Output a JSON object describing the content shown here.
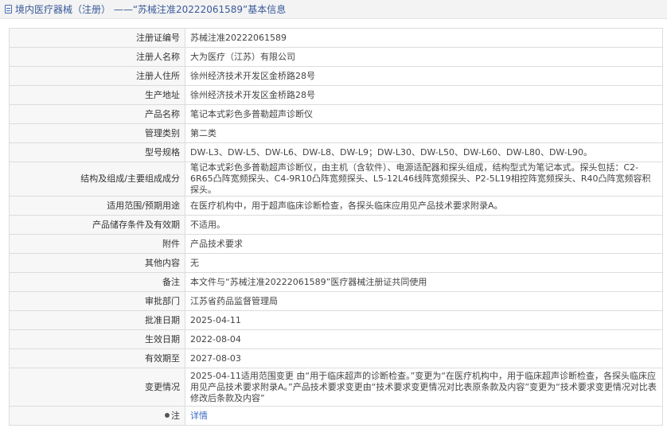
{
  "header": {
    "title": "境内医疗器械（注册） ——“苏械注准20222061589”基本信息"
  },
  "rows": [
    {
      "label": "注册证编号",
      "value": "苏械注准20222061589"
    },
    {
      "label": "注册人名称",
      "value": "大为医疗（江苏）有限公司"
    },
    {
      "label": "注册人住所",
      "value": "徐州经济技术开发区金桥路28号"
    },
    {
      "label": "生产地址",
      "value": "徐州经济技术开发区金桥路28号"
    },
    {
      "label": "产品名称",
      "value": "笔记本式彩色多普勒超声诊断仪"
    },
    {
      "label": "管理类别",
      "value": "第二类"
    },
    {
      "label": "型号规格",
      "value": "DW-L3、DW-L5、DW-L6、DW-L8、DW-L9；DW-L30、DW-L50、DW-L60、DW-L80、DW-L90。"
    },
    {
      "label": "结构及组成/主要组成成分",
      "value": "笔记本式彩色多普勒超声诊断仪，由主机（含软件）、电源适配器和探头组成，结构型式为笔记本式。探头包括：C2-6R65凸阵宽频探头、C4-9R10凸阵宽频探头、L5-12L46线阵宽频探头、P2-5L19相控阵宽频探头、R40凸阵宽频容积探头。"
    },
    {
      "label": "适用范围/预期用途",
      "value": "在医疗机构中，用于超声临床诊断检查，各探头临床应用见产品技术要求附录A。"
    },
    {
      "label": "产品储存条件及有效期",
      "value": "不适用。"
    },
    {
      "label": "附件",
      "value": "产品技术要求"
    },
    {
      "label": "其他内容",
      "value": "无"
    },
    {
      "label": "备注",
      "value": "本文件与“苏械注准20222061589”医疗器械注册证共同使用"
    },
    {
      "label": "审批部门",
      "value": "江苏省药品监督管理局"
    },
    {
      "label": "批准日期",
      "value": "2025-04-11"
    },
    {
      "label": "生效日期",
      "value": "2022-08-04"
    },
    {
      "label": "有效期至",
      "value": "2027-08-03"
    },
    {
      "label": "变更情况",
      "value": "2025-04-11适用范围变更 由“用于临床超声的诊断检查。”变更为“在医疗机构中，用于临床超声诊断检查，各探头临床应用见产品技术要求附录A。”产品技术要求变更由“技术要求变更情况对比表原条款及内容”变更为“技术要求变更情况对比表修改后条款及内容”"
    }
  ],
  "note_row": {
    "label": "注",
    "link": "详情"
  }
}
